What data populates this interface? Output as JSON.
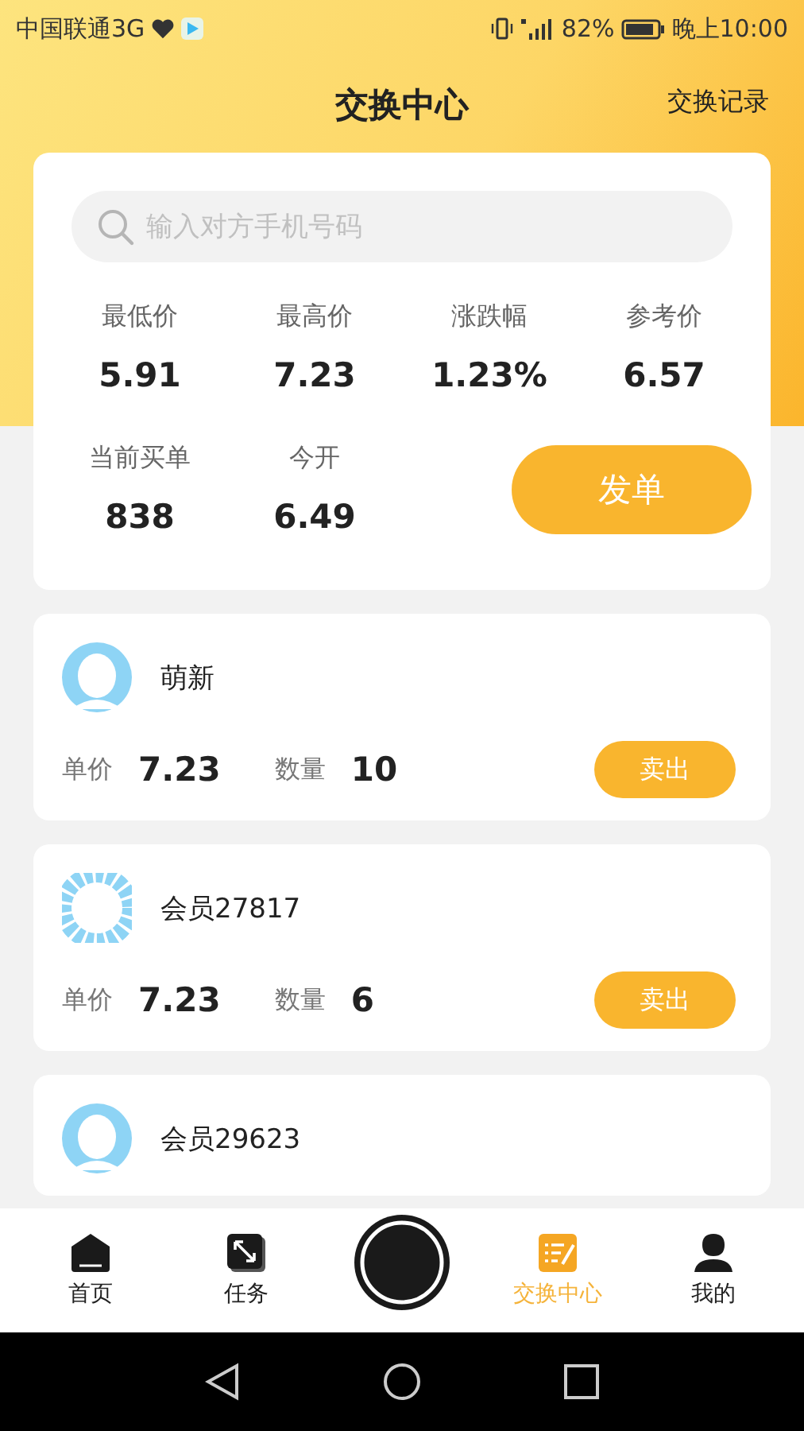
{
  "status_bar": {
    "carrier": "中国联通3G",
    "battery": "82%",
    "time": "晚上10:00"
  },
  "header": {
    "title": "交换中心",
    "action": "交换记录"
  },
  "search": {
    "placeholder": "输入对方手机号码"
  },
  "stats": [
    {
      "label": "最低价",
      "value": "5.91"
    },
    {
      "label": "最高价",
      "value": "7.23"
    },
    {
      "label": "涨跌幅",
      "value": "1.23%"
    },
    {
      "label": "参考价",
      "value": "6.57"
    },
    {
      "label": "当前买单",
      "value": "838"
    },
    {
      "label": "今开",
      "value": "6.49"
    }
  ],
  "post_button": "发单",
  "orders": [
    {
      "kind": "silhouette",
      "name": "萌新",
      "price_label": "单价",
      "price": "7.23",
      "qty_label": "数量",
      "qty": "10",
      "button": "卖出"
    },
    {
      "kind": "striped",
      "name": "会员27817",
      "price_label": "单价",
      "price": "7.23",
      "qty_label": "数量",
      "qty": "6",
      "button": "卖出"
    },
    {
      "kind": "silhouette",
      "name": "会员29623"
    }
  ],
  "nav": [
    {
      "kind": "home",
      "label": "首页",
      "selected": false
    },
    {
      "kind": "task",
      "label": "任务",
      "selected": false
    },
    {
      "kind": "center"
    },
    {
      "kind": "exchange",
      "label": "交换中心",
      "selected": true
    },
    {
      "kind": "me",
      "label": "我的",
      "selected": false
    }
  ]
}
